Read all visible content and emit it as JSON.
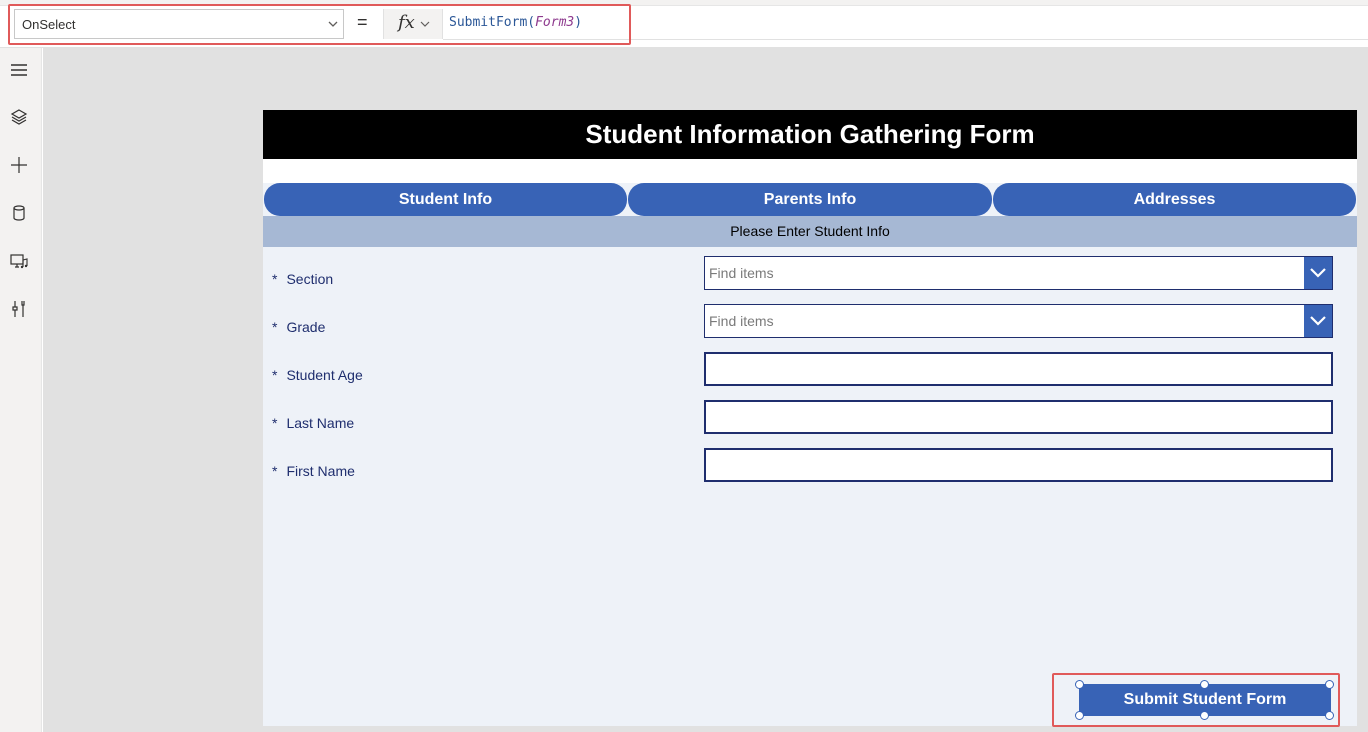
{
  "formula_bar": {
    "property": "OnSelect",
    "equals": "=",
    "fx_label": "fx",
    "formula_func": "SubmitForm(",
    "formula_arg": "Form3",
    "formula_close": ")"
  },
  "rail": {
    "icons": [
      "hamburger-icon",
      "layers-icon",
      "add-icon",
      "database-icon",
      "media-icon",
      "tools-icon"
    ]
  },
  "form": {
    "title": "Student Information Gathering Form",
    "tabs": [
      {
        "label": "Student Info"
      },
      {
        "label": "Parents Info"
      },
      {
        "label": "Addresses"
      }
    ],
    "subheader": "Please Enter Student Info",
    "fields": [
      {
        "label": "Section",
        "required": "*",
        "type": "combo",
        "placeholder": "Find items"
      },
      {
        "label": "Grade",
        "required": "*",
        "type": "combo",
        "placeholder": "Find items"
      },
      {
        "label": "Student Age",
        "required": "*",
        "type": "text",
        "value": ""
      },
      {
        "label": "Last Name",
        "required": "*",
        "type": "text",
        "value": ""
      },
      {
        "label": "First Name",
        "required": "*",
        "type": "text",
        "value": ""
      }
    ],
    "submit_label": "Submit Student Form"
  },
  "colors": {
    "accent": "#3863b6",
    "header_bg": "#000000",
    "subheader_bg": "#a6b8d4",
    "screen_bg": "#eef2f8",
    "highlight": "#e05a5a"
  }
}
